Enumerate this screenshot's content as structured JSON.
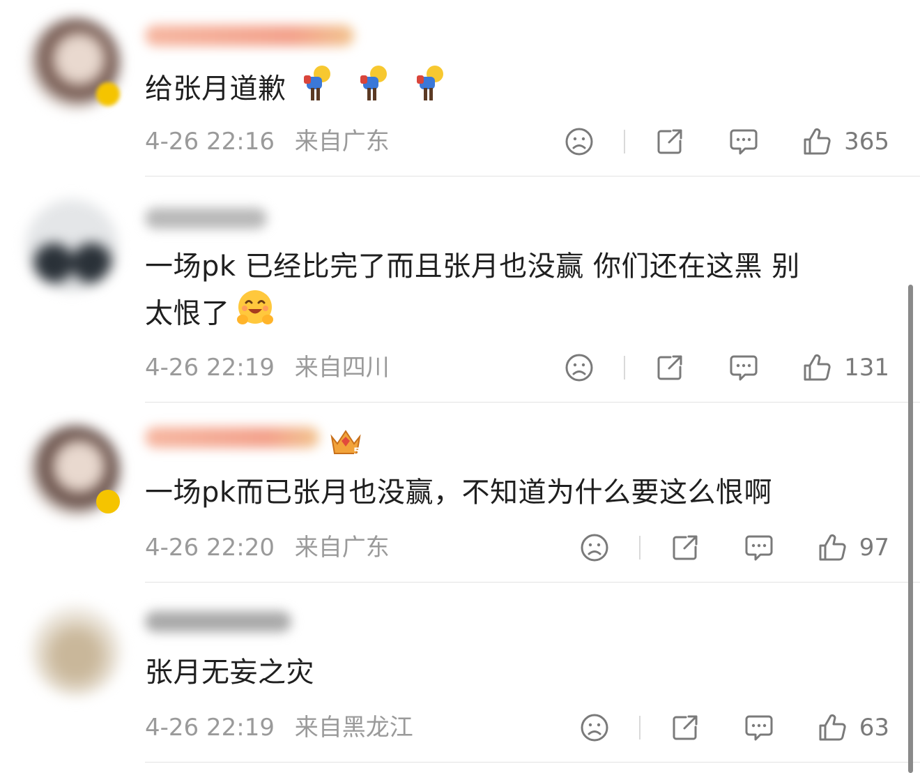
{
  "comments": [
    {
      "text": "给张月道歉",
      "emoji": "bowing-person-emoji",
      "date": "4-26 22:16",
      "location": "来自广东",
      "likes": "365"
    },
    {
      "text_line1": "一场pk 已经比完了而且张月也没赢 你们还在这黑 别",
      "text_line2": "太恨了",
      "emoji": "hugging-face-emoji",
      "date": "4-26 22:19",
      "location": "来自四川",
      "likes": "131"
    },
    {
      "text": "一场pk而已张月也没赢，不知道为什么要这么恨啊",
      "badge": "5",
      "date": "4-26 22:20",
      "location": "来自广东",
      "likes": "97"
    },
    {
      "text": "张月无妄之灾",
      "date": "4-26 22:19",
      "location": "来自黑龙江",
      "likes": "63"
    }
  ],
  "icons": [
    "sad-face-icon",
    "share-icon",
    "comment-icon",
    "like-icon"
  ],
  "colors": {
    "text": "#1f1f1f",
    "meta": "#9a9a9a",
    "icon": "#7a7a7a",
    "divider": "#e3e3e3",
    "vip_gold": "#f5b800"
  }
}
